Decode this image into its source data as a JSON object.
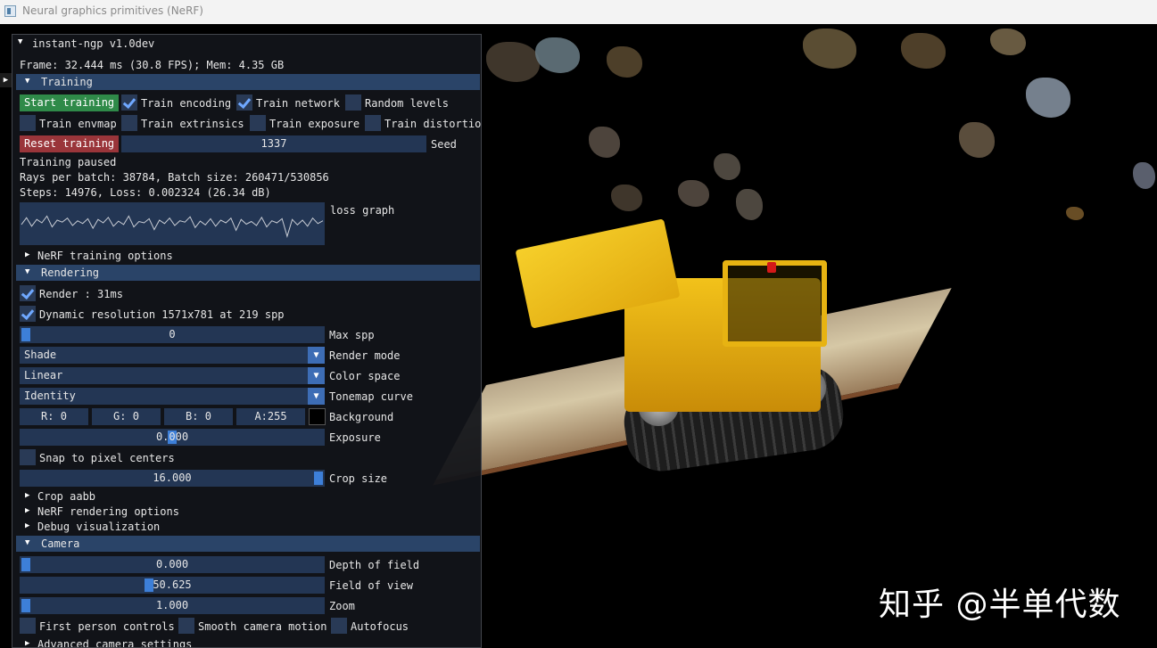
{
  "window": {
    "title": "Neural graphics primitives (NeRF)"
  },
  "panel": {
    "title": "instant-ngp v1.0dev",
    "stats": "Frame: 32.444 ms (30.8 FPS); Mem: 4.35 GB"
  },
  "training": {
    "header": "Training",
    "start_button": "Start training",
    "train_encoding": "Train encoding",
    "train_network": "Train network",
    "random_levels": "Random levels",
    "train_envmap": "Train envmap",
    "train_extrinsics": "Train extrinsics",
    "train_exposure": "Train exposure",
    "train_distortion": "Train distortio",
    "reset_button": "Reset training",
    "seed_value": "1337",
    "seed_label": "Seed",
    "status": "Training paused",
    "rays": "Rays per batch: 38784, Batch size: 260471/530856",
    "steps": "Steps: 14976, Loss: 0.002324 (26.34 dB)",
    "loss_graph_label": "loss graph",
    "nerf_training_options": "NeRF training options",
    "states": {
      "train_encoding": true,
      "train_network": true,
      "random_levels": false,
      "train_envmap": false,
      "train_extrinsics": false,
      "train_exposure": false,
      "train_distortion": false
    }
  },
  "rendering": {
    "header": "Rendering",
    "render": "Render : 31ms",
    "dynamic_resolution": "Dynamic resolution 1571x781 at 219 spp",
    "max_spp_value": "0",
    "max_spp_label": "Max spp",
    "render_mode_value": "Shade",
    "render_mode_label": "Render mode",
    "color_space_value": "Linear",
    "color_space_label": "Color space",
    "tonemap_value": "Identity",
    "tonemap_label": "Tonemap curve",
    "bg_r": "R:  0",
    "bg_g": "G:  0",
    "bg_b": "B:  0",
    "bg_a": "A:255",
    "background_label": "Background",
    "exposure_value": "0.000",
    "exposure_label": "Exposure",
    "snap": "Snap to pixel centers",
    "crop_value": "16.000",
    "crop_label": "Crop size",
    "crop_aabb": "Crop aabb",
    "nerf_rendering_options": "NeRF rendering options",
    "debug_visualization": "Debug visualization",
    "states": {
      "render": true,
      "dynamic_resolution": true,
      "snap": false
    }
  },
  "camera": {
    "header": "Camera",
    "dof_value": "0.000",
    "dof_label": "Depth of field",
    "fov_value": "50.625",
    "fov_label": "Field of view",
    "zoom_value": "1.000",
    "zoom_label": "Zoom",
    "first_person": "First person controls",
    "smooth_motion": "Smooth camera motion",
    "autofocus": "Autofocus",
    "advanced": "Advanced camera settings",
    "states": {
      "first_person": false,
      "smooth_motion": false,
      "autofocus": false
    }
  },
  "loss_curve": [
    0.55,
    0.35,
    0.6,
    0.4,
    0.5,
    0.3,
    0.62,
    0.42,
    0.48,
    0.36,
    0.58,
    0.44,
    0.52,
    0.38,
    0.66,
    0.4,
    0.5,
    0.34,
    0.6,
    0.45,
    0.55,
    0.3,
    0.62,
    0.46,
    0.5,
    0.38,
    0.7,
    0.42,
    0.52,
    0.36,
    0.58,
    0.44,
    0.48,
    0.32,
    0.64,
    0.45,
    0.56,
    0.38,
    0.6,
    0.42,
    0.5,
    0.36,
    0.72,
    0.4,
    0.54,
    0.46,
    0.58,
    0.34,
    0.62,
    0.44,
    0.5,
    0.38,
    0.9,
    0.4,
    0.56,
    0.42,
    0.6,
    0.36,
    0.52,
    0.44
  ],
  "overlay_text": "知乎 @半单代数",
  "colors": {
    "panel_bg": "#12141a",
    "header": "#2a4468",
    "accent": "#3d7fd8",
    "start": "#2f8a49",
    "reset": "#9a353a"
  }
}
